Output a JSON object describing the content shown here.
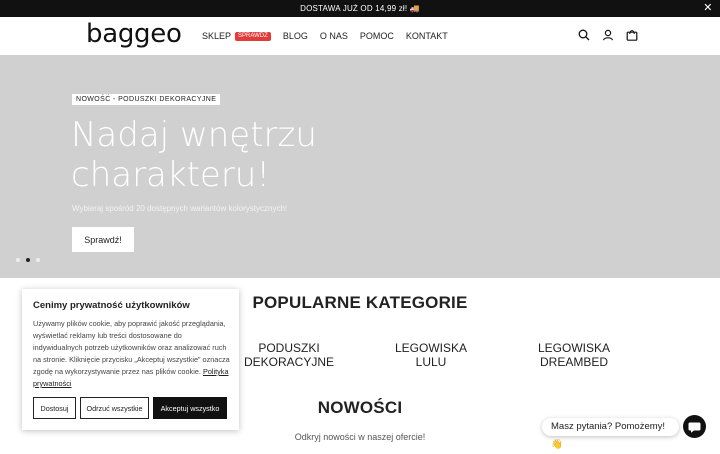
{
  "topbar": {
    "text": "DOSTAWA JUŻ OD 14,99 zł! 🚚",
    "close": "✕"
  },
  "header": {
    "logo": "baggeo",
    "nav": [
      {
        "label": "SKLEP",
        "badge": "SPRAWDŹ"
      },
      {
        "label": "BLOG"
      },
      {
        "label": "O NAS"
      },
      {
        "label": "POMOC"
      },
      {
        "label": "KONTAKT"
      }
    ],
    "icons": [
      "search-icon",
      "user-icon",
      "cart-icon"
    ]
  },
  "hero": {
    "tag": "NOWOŚĆ - PODUSZKI DEKORACYJNE",
    "title": "Nadaj wnętrzu charakteru!",
    "subtitle": "Wybieraj spośród 20 dostępnych wariantów kolorystycznych!",
    "button": "Sprawdź!",
    "slides_active": 2
  },
  "popular": {
    "title": "POPULARNE KATEGORIE",
    "items": [
      "PODUSZKI DEKORACYJNE",
      "LEGOWISKA LULU",
      "LEGOWISKA DREAMBED"
    ]
  },
  "news": {
    "title": "NOWOŚCI",
    "subtitle": "Odkryj nowości w naszej ofercie!"
  },
  "cookie": {
    "title": "Cenimy prywatność użytkowników",
    "text": "Używamy plików cookie, aby poprawić jakość przeglądania, wyświetlać reklamy lub treści dostosowane do indywidualnych potrzeb użytkowników oraz analizować ruch na stronie. Kliknięcie przycisku „Akceptuj wszystkie” oznacza zgodę na wykorzystywanie przez nas plików cookie.",
    "link": "Polityka prywatności",
    "buttons": {
      "customize": "Dostosuj",
      "reject": "Odrzuć wszystkie",
      "accept": "Akceptuj wszystko"
    }
  },
  "chat": {
    "label": "Masz pytania? Pomożemy! 👋",
    "icon": "chat-icon"
  },
  "colors": {
    "badge": "#e23b3b",
    "hero_bg": "#d0d0d0",
    "dark": "#111111"
  }
}
